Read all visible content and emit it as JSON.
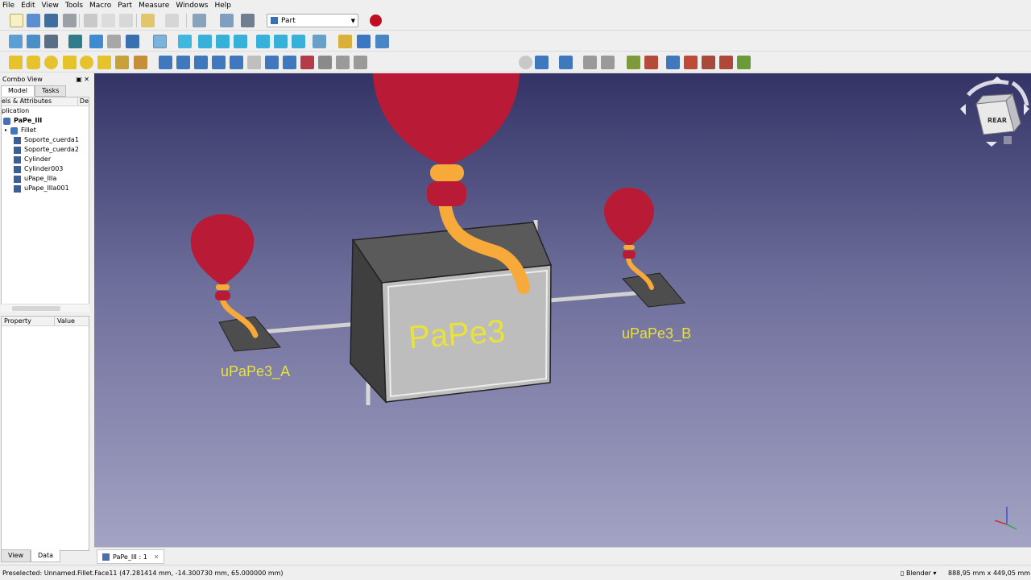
{
  "menu": [
    "File",
    "Edit",
    "View",
    "Tools",
    "Macro",
    "Part",
    "Measure",
    "Windows",
    "Help"
  ],
  "workbench": {
    "selected": "Part"
  },
  "combo_view": {
    "title": "Combo View",
    "tabs": [
      "Model",
      "Tasks"
    ],
    "tree_header": {
      "col1": "els & Attributes",
      "col2": "De"
    },
    "tree_root": "plication",
    "document": "PaPe_III",
    "items": [
      "Fillet",
      "Soporte_cuerda1",
      "Soporte_cuerda2",
      "Cylinder",
      "Cylinder003",
      "uPape_IIIa",
      "uPape_IIIa001"
    ]
  },
  "property_view": {
    "col_property": "Property",
    "col_value": "Value",
    "tabs": [
      "View",
      "Data"
    ]
  },
  "scene": {
    "main_label": "PaPe3",
    "left_label": "uPaPe3_A",
    "right_label": "uPaPe3_B",
    "navcube_face": "REAR",
    "balloon_color": "#b91b37",
    "string_color": "#f7a93a",
    "label_color": "#e8e23a"
  },
  "doc_tab": {
    "label": "PaPe_III : 1"
  },
  "status": {
    "message": "Preselected: Unnamed.Fillet.Face11 (47.281414 mm, -14.300730 mm, 65.000000 mm)",
    "nav_style": "Blender",
    "dimensions": "888,95 mm x 449,05 mm"
  }
}
